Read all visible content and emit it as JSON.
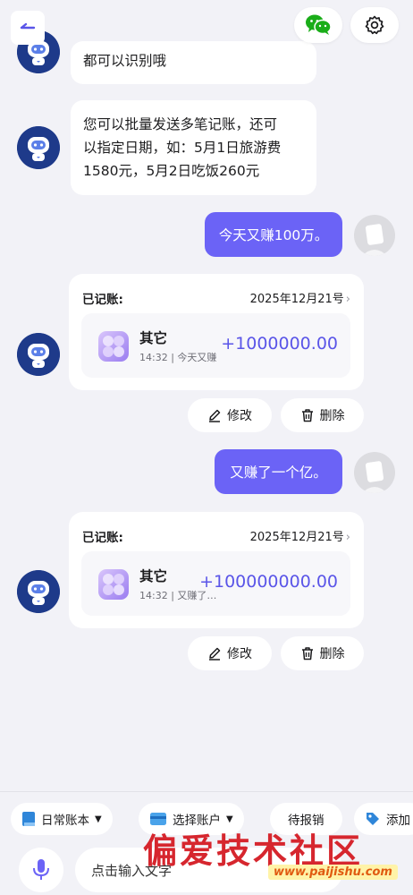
{
  "header": {
    "back_icon": "back-arrow-icon",
    "wechat_icon": "wechat-icon",
    "settings_icon": "gear-icon"
  },
  "messages": {
    "bot1_tail": "都可以识别哦",
    "bot2_lines": [
      "您可以批量发送多笔记账，还可",
      "以指定日期，如：5月1日旅游费",
      "1580元，5月2日吃饭260元"
    ],
    "user1": "今天又赚100万。",
    "user2": "又赚了一个亿。"
  },
  "cards": [
    {
      "label": "已记账:",
      "date": "2025年12月21号",
      "category": "其它",
      "time": "14:32",
      "note": "今天又赚",
      "amount": "+1000000.00"
    },
    {
      "label": "已记账:",
      "date": "2025年12月21号",
      "category": "其它",
      "time": "14:32",
      "note": "又赚了…",
      "amount": "+100000000.00"
    }
  ],
  "actions": {
    "edit_label": "修改",
    "delete_label": "删除"
  },
  "toolbar": {
    "ledger_label": "日常账本",
    "account_label": "选择账户",
    "reimburse_label": "待报销",
    "tag_label": "添加"
  },
  "input": {
    "placeholder": "点击输入文字"
  },
  "watermark": {
    "title": "偏爱技术社区",
    "url": "www.paijishu.com"
  },
  "colors": {
    "accent": "#6b63f6",
    "amount": "#5a55e8",
    "background": "#f2f2f7"
  }
}
